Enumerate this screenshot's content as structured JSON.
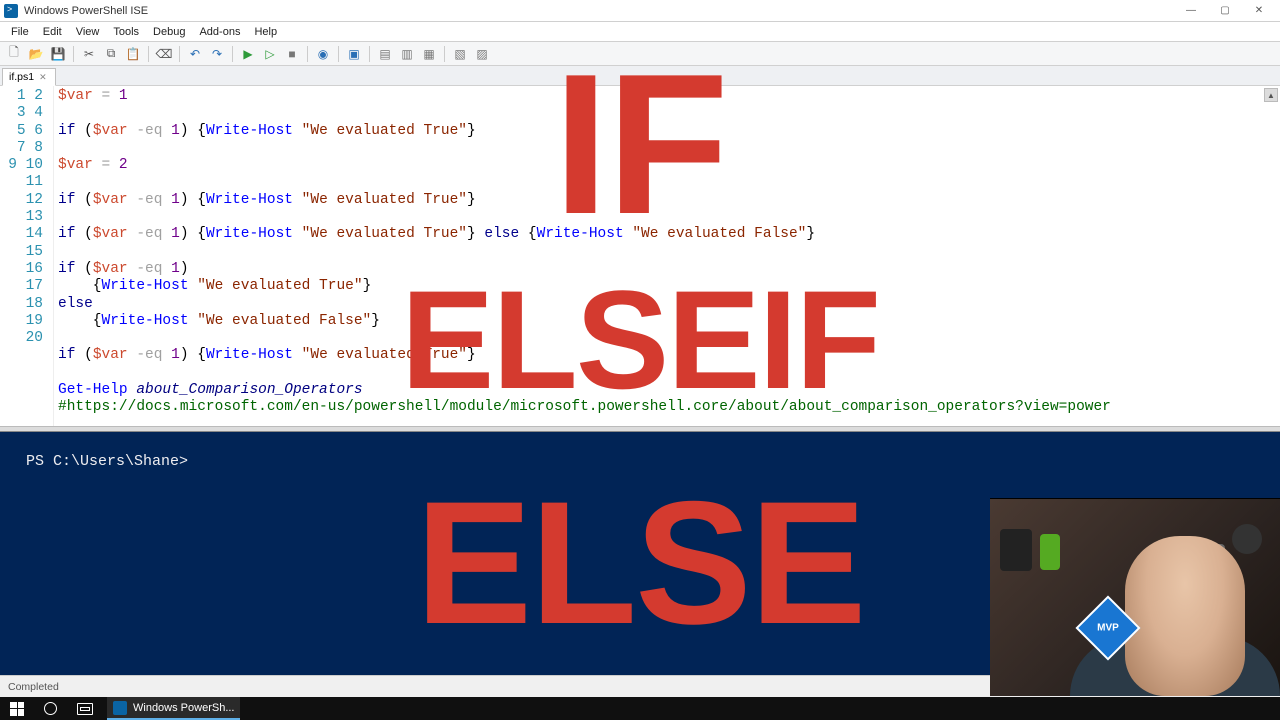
{
  "window": {
    "title": "Windows PowerShell ISE",
    "min": "—",
    "max": "▢",
    "close": "✕"
  },
  "menu": {
    "items": [
      "File",
      "Edit",
      "View",
      "Tools",
      "Debug",
      "Add-ons",
      "Help"
    ]
  },
  "toolbar": {
    "buttons": [
      {
        "name": "new-file-icon",
        "glyph": "🗋",
        "color": "#555"
      },
      {
        "name": "open-file-icon",
        "glyph": "📂",
        "color": "#d9a441"
      },
      {
        "name": "save-icon",
        "glyph": "💾",
        "color": "#2a6fb5"
      },
      {
        "name": "sep"
      },
      {
        "name": "cut-icon",
        "glyph": "✂",
        "color": "#555"
      },
      {
        "name": "copy-icon",
        "glyph": "⧉",
        "color": "#555"
      },
      {
        "name": "paste-icon",
        "glyph": "📋",
        "color": "#555"
      },
      {
        "name": "sep"
      },
      {
        "name": "clear-icon",
        "glyph": "⌫",
        "color": "#555"
      },
      {
        "name": "sep"
      },
      {
        "name": "undo-icon",
        "glyph": "↶",
        "color": "#2a6fb5"
      },
      {
        "name": "redo-icon",
        "glyph": "↷",
        "color": "#2a6fb5"
      },
      {
        "name": "sep"
      },
      {
        "name": "run-script-icon",
        "glyph": "▶",
        "color": "#2e9b3a"
      },
      {
        "name": "run-selection-icon",
        "glyph": "▷",
        "color": "#2e9b3a"
      },
      {
        "name": "stop-icon",
        "glyph": "■",
        "color": "#777"
      },
      {
        "name": "sep"
      },
      {
        "name": "remote-icon",
        "glyph": "◉",
        "color": "#2a6fb5"
      },
      {
        "name": "sep"
      },
      {
        "name": "new-remote-icon",
        "glyph": "▣",
        "color": "#2a6fb5"
      },
      {
        "name": "sep"
      },
      {
        "name": "layout1-icon",
        "glyph": "▤",
        "color": "#777"
      },
      {
        "name": "layout2-icon",
        "glyph": "▥",
        "color": "#777"
      },
      {
        "name": "layout3-icon",
        "glyph": "▦",
        "color": "#777"
      },
      {
        "name": "sep"
      },
      {
        "name": "show-commands-icon",
        "glyph": "▧",
        "color": "#777"
      },
      {
        "name": "show-script-icon",
        "glyph": "▨",
        "color": "#777"
      }
    ]
  },
  "tab": {
    "label": "if.ps1",
    "close": "✕"
  },
  "code": {
    "line_count": 20,
    "lines": [
      [
        {
          "t": "$var",
          "c": "c-var"
        },
        {
          "t": " "
        },
        {
          "t": "=",
          "c": "c-op"
        },
        {
          "t": " "
        },
        {
          "t": "1",
          "c": "c-num"
        }
      ],
      [],
      [
        {
          "t": "if",
          "c": "c-kw"
        },
        {
          "t": " ("
        },
        {
          "t": "$var",
          "c": "c-var"
        },
        {
          "t": " "
        },
        {
          "t": "-eq",
          "c": "c-op"
        },
        {
          "t": " "
        },
        {
          "t": "1",
          "c": "c-num"
        },
        {
          "t": ") {"
        },
        {
          "t": "Write-Host",
          "c": "c-cmd"
        },
        {
          "t": " "
        },
        {
          "t": "\"We evaluated True\"",
          "c": "c-str"
        },
        {
          "t": "}"
        }
      ],
      [],
      [
        {
          "t": "$var",
          "c": "c-var"
        },
        {
          "t": " "
        },
        {
          "t": "=",
          "c": "c-op"
        },
        {
          "t": " "
        },
        {
          "t": "2",
          "c": "c-num"
        }
      ],
      [],
      [
        {
          "t": "if",
          "c": "c-kw"
        },
        {
          "t": " ("
        },
        {
          "t": "$var",
          "c": "c-var"
        },
        {
          "t": " "
        },
        {
          "t": "-eq",
          "c": "c-op"
        },
        {
          "t": " "
        },
        {
          "t": "1",
          "c": "c-num"
        },
        {
          "t": ") {"
        },
        {
          "t": "Write-Host",
          "c": "c-cmd"
        },
        {
          "t": " "
        },
        {
          "t": "\"We evaluated True\"",
          "c": "c-str"
        },
        {
          "t": "}"
        }
      ],
      [],
      [
        {
          "t": "if",
          "c": "c-kw"
        },
        {
          "t": " ("
        },
        {
          "t": "$var",
          "c": "c-var"
        },
        {
          "t": " "
        },
        {
          "t": "-eq",
          "c": "c-op"
        },
        {
          "t": " "
        },
        {
          "t": "1",
          "c": "c-num"
        },
        {
          "t": ") {"
        },
        {
          "t": "Write-Host",
          "c": "c-cmd"
        },
        {
          "t": " "
        },
        {
          "t": "\"We evaluated True\"",
          "c": "c-str"
        },
        {
          "t": "} "
        },
        {
          "t": "else",
          "c": "c-kw"
        },
        {
          "t": " {"
        },
        {
          "t": "Write-Host",
          "c": "c-cmd"
        },
        {
          "t": " "
        },
        {
          "t": "\"We evaluated False\"",
          "c": "c-str"
        },
        {
          "t": "}"
        }
      ],
      [],
      [
        {
          "t": "if",
          "c": "c-kw"
        },
        {
          "t": " ("
        },
        {
          "t": "$var",
          "c": "c-var"
        },
        {
          "t": " "
        },
        {
          "t": "-eq",
          "c": "c-op"
        },
        {
          "t": " "
        },
        {
          "t": "1",
          "c": "c-num"
        },
        {
          "t": ")"
        }
      ],
      [
        {
          "t": "    {"
        },
        {
          "t": "Write-Host",
          "c": "c-cmd"
        },
        {
          "t": " "
        },
        {
          "t": "\"We evaluated True\"",
          "c": "c-str"
        },
        {
          "t": "}"
        }
      ],
      [
        {
          "t": "else",
          "c": "c-kw"
        }
      ],
      [
        {
          "t": "    {"
        },
        {
          "t": "Write-Host",
          "c": "c-cmd"
        },
        {
          "t": " "
        },
        {
          "t": "\"We evaluated False\"",
          "c": "c-str"
        },
        {
          "t": "}"
        }
      ],
      [],
      [
        {
          "t": "if",
          "c": "c-kw"
        },
        {
          "t": " ("
        },
        {
          "t": "$var",
          "c": "c-var"
        },
        {
          "t": " "
        },
        {
          "t": "-eq",
          "c": "c-op"
        },
        {
          "t": " "
        },
        {
          "t": "1",
          "c": "c-num"
        },
        {
          "t": ") {"
        },
        {
          "t": "Write-Host",
          "c": "c-cmd"
        },
        {
          "t": " "
        },
        {
          "t": "\"We evaluated True\"",
          "c": "c-str"
        },
        {
          "t": "}"
        }
      ],
      [],
      [
        {
          "t": "Get-Help",
          "c": "c-cmd"
        },
        {
          "t": " "
        },
        {
          "t": "about_Comparison_Operators",
          "c": "c-arg"
        }
      ],
      [
        {
          "t": "#https://docs.microsoft.com/en-us/powershell/module/microsoft.powershell.core/about/about_comparison_operators?view=power",
          "c": "c-com"
        }
      ],
      []
    ]
  },
  "console": {
    "prompt": "PS C:\\Users\\Shane>"
  },
  "status": {
    "text": "Completed"
  },
  "taskbar": {
    "app_label": "Windows PowerSh..."
  },
  "overlay": {
    "l1": "IF",
    "l2": "ELSEIF",
    "l3": "ELSE"
  },
  "webcam": {
    "badge": "MVP"
  }
}
